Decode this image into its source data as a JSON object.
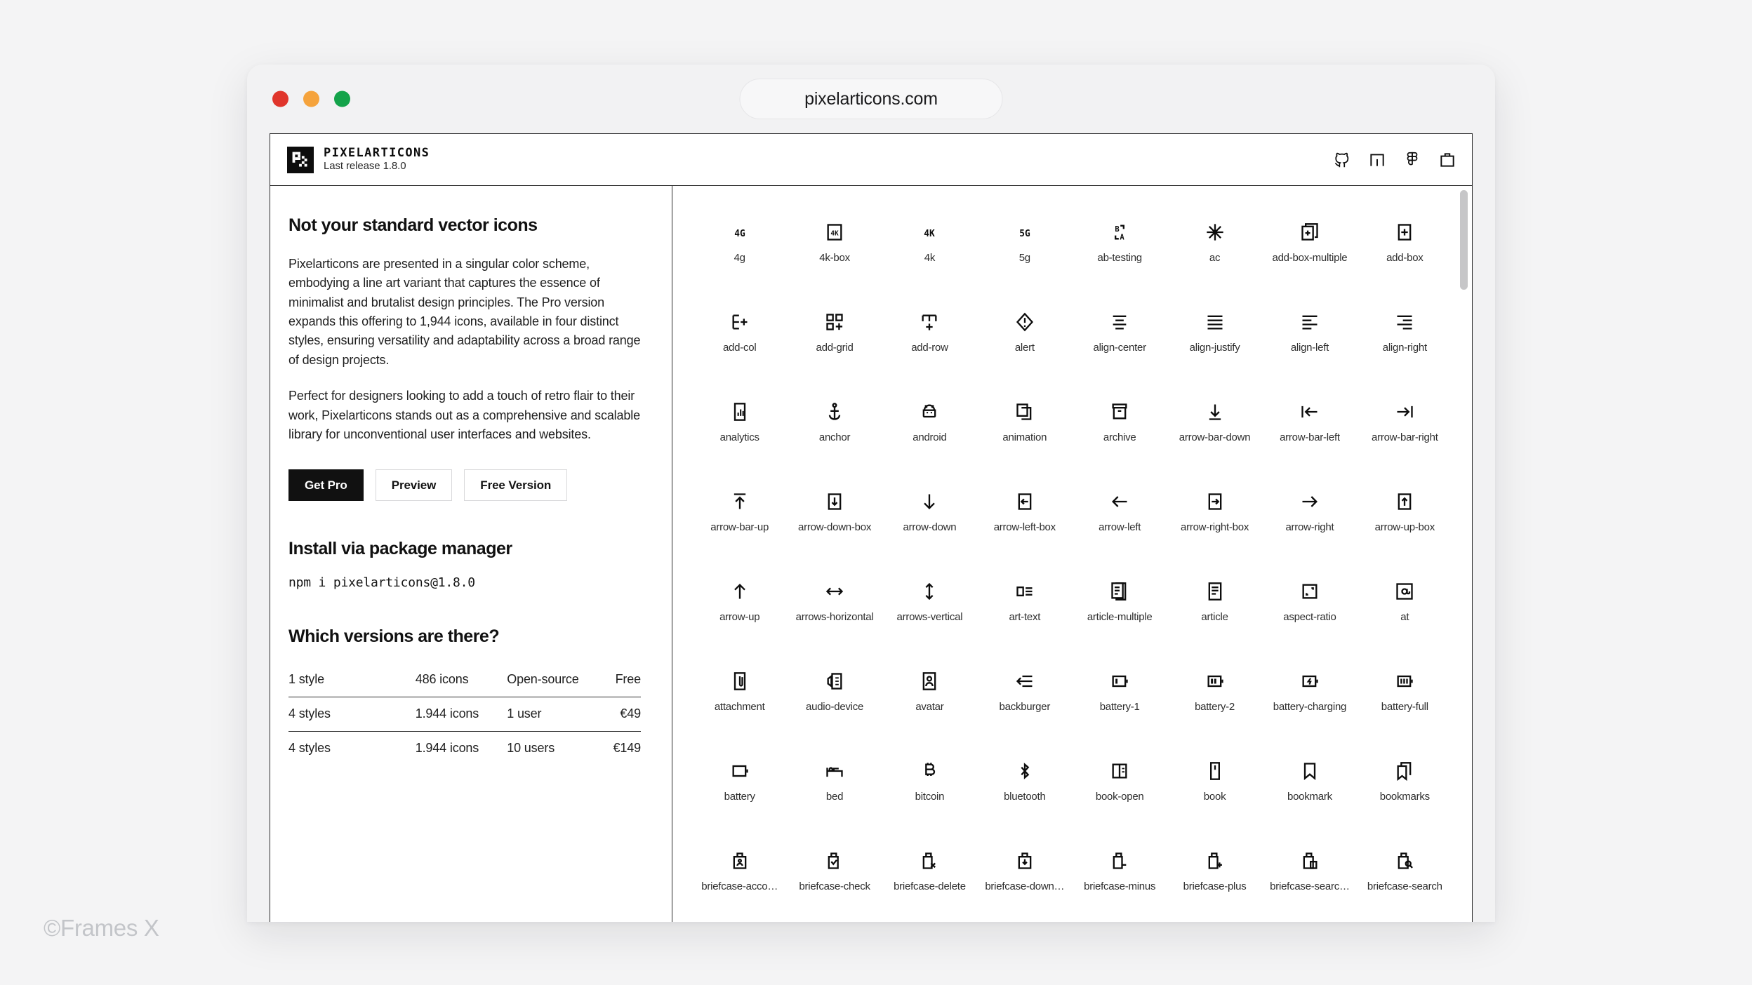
{
  "watermark": "©Frames X",
  "browser": {
    "url": "pixelarticons.com",
    "traffic_lights": [
      {
        "name": "close",
        "color": "#e0352b"
      },
      {
        "name": "minimize",
        "color": "#f5a33c"
      },
      {
        "name": "maximize",
        "color": "#14a34a"
      }
    ]
  },
  "site_header": {
    "brand_name": "PIXELARTICONS",
    "brand_release": "Last release 1.8.0",
    "icons": [
      "github-icon",
      "npm-icon",
      "figma-icon",
      "briefcase-icon"
    ]
  },
  "left": {
    "heading": "Not your standard vector icons",
    "paragraph_1": "Pixelarticons are presented in a singular color scheme, embodying a line art variant that captures the essence of minimalist and brutalist design principles. The Pro version expands this offering to 1,944 icons, available in four distinct styles, ensuring versatility and adaptability across a broad range of design projects.",
    "paragraph_2": "Perfect for designers looking to add a touch of retro flair to their work, Pixelarticons stands out as a comprehensive and scalable library for unconventional user interfaces and websites.",
    "buttons": [
      {
        "label": "Get Pro",
        "primary": true
      },
      {
        "label": "Preview",
        "primary": false
      },
      {
        "label": "Free Version",
        "primary": false
      }
    ],
    "install_heading": "Install via package manager",
    "install_command": "npm i pixelarticons@1.8.0",
    "versions_heading": "Which versions are there?",
    "versions_rows": [
      [
        "1 style",
        "486 icons",
        "Open-source",
        "Free"
      ],
      [
        "4 styles",
        "1.944 icons",
        "1 user",
        "€49"
      ],
      [
        "4 styles",
        "1.944 icons",
        "10 users",
        "€149"
      ]
    ]
  },
  "icon_grid": {
    "columns": 8,
    "items": [
      {
        "label": "4g",
        "glyph": "4g"
      },
      {
        "label": "4k-box",
        "glyph": "4k-box"
      },
      {
        "label": "4k",
        "glyph": "4k"
      },
      {
        "label": "5g",
        "glyph": "5g"
      },
      {
        "label": "ab-testing",
        "glyph": "ab-testing"
      },
      {
        "label": "ac",
        "glyph": "ac"
      },
      {
        "label": "add-box-multiple",
        "glyph": "add-box-multiple"
      },
      {
        "label": "add-box",
        "glyph": "add-box"
      },
      {
        "label": "add-col",
        "glyph": "add-col"
      },
      {
        "label": "add-grid",
        "glyph": "add-grid"
      },
      {
        "label": "add-row",
        "glyph": "add-row"
      },
      {
        "label": "alert",
        "glyph": "alert"
      },
      {
        "label": "align-center",
        "glyph": "align-center"
      },
      {
        "label": "align-justify",
        "glyph": "align-justify"
      },
      {
        "label": "align-left",
        "glyph": "align-left"
      },
      {
        "label": "align-right",
        "glyph": "align-right"
      },
      {
        "label": "analytics",
        "glyph": "analytics"
      },
      {
        "label": "anchor",
        "glyph": "anchor"
      },
      {
        "label": "android",
        "glyph": "android"
      },
      {
        "label": "animation",
        "glyph": "animation"
      },
      {
        "label": "archive",
        "glyph": "archive"
      },
      {
        "label": "arrow-bar-down",
        "glyph": "arrow-bar-down"
      },
      {
        "label": "arrow-bar-left",
        "glyph": "arrow-bar-left"
      },
      {
        "label": "arrow-bar-right",
        "glyph": "arrow-bar-right"
      },
      {
        "label": "arrow-bar-up",
        "glyph": "arrow-bar-up"
      },
      {
        "label": "arrow-down-box",
        "glyph": "arrow-down-box"
      },
      {
        "label": "arrow-down",
        "glyph": "arrow-down"
      },
      {
        "label": "arrow-left-box",
        "glyph": "arrow-left-box"
      },
      {
        "label": "arrow-left",
        "glyph": "arrow-left"
      },
      {
        "label": "arrow-right-box",
        "glyph": "arrow-right-box"
      },
      {
        "label": "arrow-right",
        "glyph": "arrow-right"
      },
      {
        "label": "arrow-up-box",
        "glyph": "arrow-up-box"
      },
      {
        "label": "arrow-up",
        "glyph": "arrow-up"
      },
      {
        "label": "arrows-horizontal",
        "glyph": "arrows-horizontal"
      },
      {
        "label": "arrows-vertical",
        "glyph": "arrows-vertical"
      },
      {
        "label": "art-text",
        "glyph": "art-text"
      },
      {
        "label": "article-multiple",
        "glyph": "article-multiple"
      },
      {
        "label": "article",
        "glyph": "article"
      },
      {
        "label": "aspect-ratio",
        "glyph": "aspect-ratio"
      },
      {
        "label": "at",
        "glyph": "at"
      },
      {
        "label": "attachment",
        "glyph": "attachment"
      },
      {
        "label": "audio-device",
        "glyph": "audio-device"
      },
      {
        "label": "avatar",
        "glyph": "avatar"
      },
      {
        "label": "backburger",
        "glyph": "backburger"
      },
      {
        "label": "battery-1",
        "glyph": "battery-1"
      },
      {
        "label": "battery-2",
        "glyph": "battery-2"
      },
      {
        "label": "battery-charging",
        "glyph": "battery-charging"
      },
      {
        "label": "battery-full",
        "glyph": "battery-full"
      },
      {
        "label": "battery",
        "glyph": "battery"
      },
      {
        "label": "bed",
        "glyph": "bed"
      },
      {
        "label": "bitcoin",
        "glyph": "bitcoin"
      },
      {
        "label": "bluetooth",
        "glyph": "bluetooth"
      },
      {
        "label": "book-open",
        "glyph": "book-open"
      },
      {
        "label": "book",
        "glyph": "book"
      },
      {
        "label": "bookmark",
        "glyph": "bookmark"
      },
      {
        "label": "bookmarks",
        "glyph": "bookmarks"
      },
      {
        "label": "briefcase-acco…",
        "glyph": "briefcase-account"
      },
      {
        "label": "briefcase-check",
        "glyph": "briefcase-check"
      },
      {
        "label": "briefcase-delete",
        "glyph": "briefcase-delete"
      },
      {
        "label": "briefcase-down…",
        "glyph": "briefcase-download"
      },
      {
        "label": "briefcase-minus",
        "glyph": "briefcase-minus"
      },
      {
        "label": "briefcase-plus",
        "glyph": "briefcase-plus"
      },
      {
        "label": "briefcase-searc…",
        "glyph": "briefcase-search-box"
      },
      {
        "label": "briefcase-search",
        "glyph": "briefcase-search"
      }
    ]
  }
}
